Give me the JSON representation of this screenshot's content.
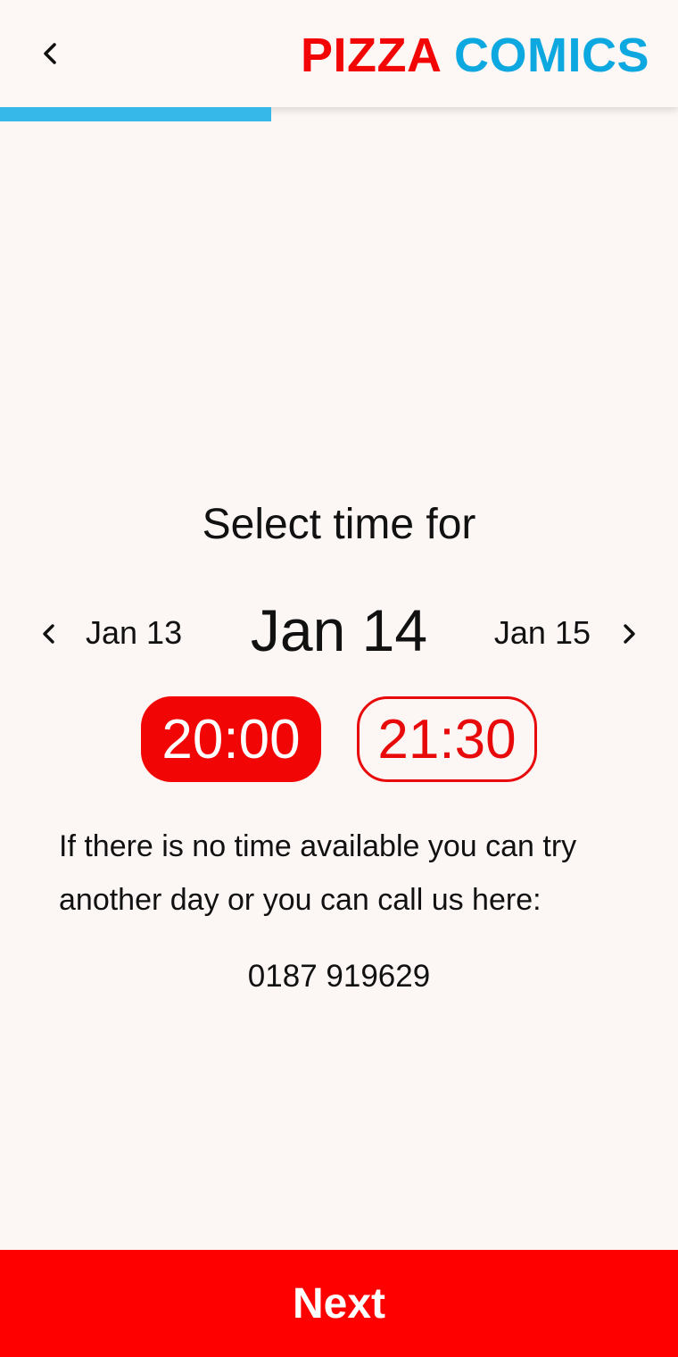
{
  "header": {
    "back_icon": "chevron-left-icon",
    "logo_word1": "PIZZA",
    "logo_word2": "COMICS",
    "logo_color1": "#f20505",
    "logo_color2": "#0ea8e0"
  },
  "progress": {
    "fraction": 0.4,
    "color": "#36b8e8"
  },
  "main": {
    "title": "Select time for",
    "date_nav": {
      "prev_icon": "chevron-left-icon",
      "prev_date": "Jan 13",
      "current_date": "Jan 14",
      "next_date": "Jan 15",
      "next_icon": "chevron-right-icon"
    },
    "time_slots": [
      {
        "label": "20:00",
        "selected": true
      },
      {
        "label": "21:30",
        "selected": false
      }
    ],
    "info_text": "If there is no time available you can try another day or you can call us here:",
    "phone": "0187 919629"
  },
  "footer": {
    "next_label": "Next",
    "color": "#ff0000"
  }
}
